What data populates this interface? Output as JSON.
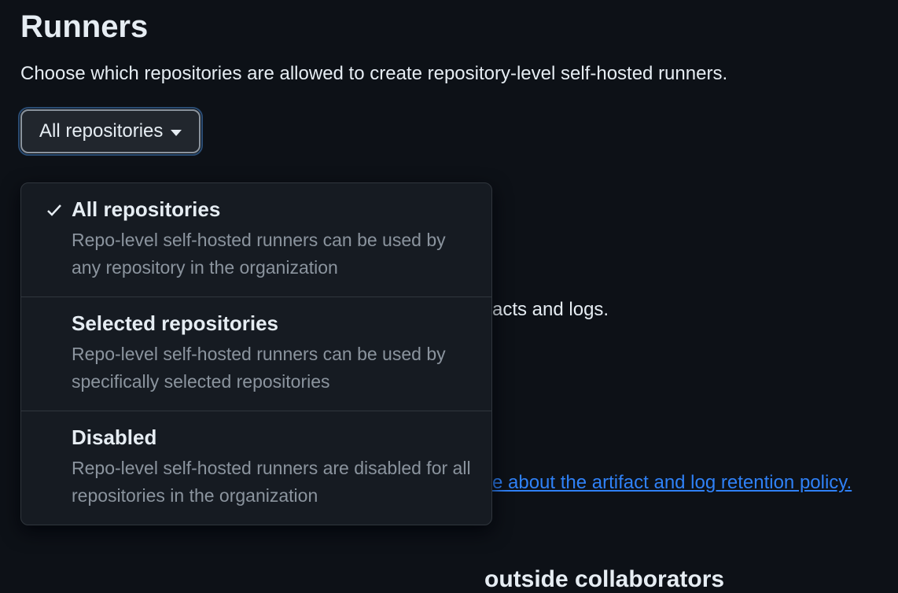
{
  "section": {
    "heading": "Runners",
    "description": "Choose which repositories are allowed to create repository-level self-hosted runners."
  },
  "select": {
    "label": "All repositories"
  },
  "dropdown": {
    "items": [
      {
        "title": "All repositories",
        "desc": "Repo-level self-hosted runners can be used by any repository in the organization",
        "checked": true
      },
      {
        "title": "Selected repositories",
        "desc": "Repo-level self-hosted runners can be used by specifically selected repositories",
        "checked": false
      },
      {
        "title": "Disabled",
        "desc": "Repo-level self-hosted runners are disabled for all repositories in the organization",
        "checked": false
      }
    ]
  },
  "background": {
    "line1": "acts and logs.",
    "link": "e about the artifact and log retention policy.",
    "heading": " outside collaborators"
  }
}
